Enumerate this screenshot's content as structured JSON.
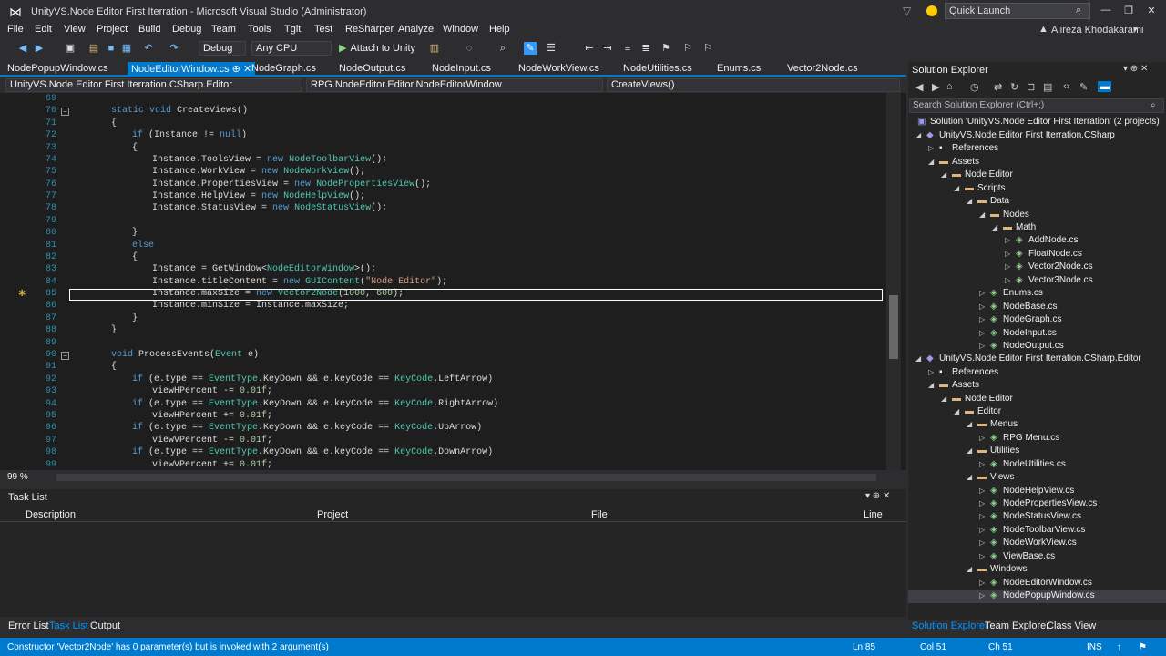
{
  "window": {
    "title": "UnityVS.Node Editor First Iterration - Microsoft Visual Studio (Administrator)",
    "quick_launch": "Quick Launch",
    "user": "Alireza Khodakarami"
  },
  "menu": [
    "File",
    "Edit",
    "View",
    "Project",
    "Build",
    "Debug",
    "Team",
    "Tools",
    "Tgit",
    "Test",
    "ReSharper",
    "Analyze",
    "Window",
    "Help"
  ],
  "toolbar": {
    "config": "Debug",
    "platform": "Any CPU",
    "attach": "Attach to Unity"
  },
  "tabs": [
    {
      "label": "NodePopupWindow.cs",
      "active": false
    },
    {
      "label": "NodeEditorWindow.cs",
      "active": true
    },
    {
      "label": "NodeGraph.cs",
      "active": false
    },
    {
      "label": "NodeOutput.cs",
      "active": false
    },
    {
      "label": "NodeInput.cs",
      "active": false
    },
    {
      "label": "NodeWorkView.cs",
      "active": false
    },
    {
      "label": "NodeUtilities.cs",
      "active": false
    },
    {
      "label": "Enums.cs",
      "active": false
    },
    {
      "label": "Vector2Node.cs",
      "active": false
    }
  ],
  "navbar": {
    "project": "UnityVS.Node Editor First Iterration.CSharp.Editor",
    "class": "RPG.NodeEditor.Editor.NodeEditorWindow",
    "member": "CreateViews()"
  },
  "code": {
    "line_numbers": [
      "69",
      "70",
      "71",
      "72",
      "73",
      "74",
      "75",
      "76",
      "77",
      "78",
      "79",
      "80",
      "81",
      "82",
      "83",
      "84",
      "85",
      "86",
      "87",
      "88",
      "89",
      "90",
      "91",
      "92",
      "93",
      "94",
      "95",
      "96",
      "97",
      "98",
      "99"
    ],
    "zoom": "99 %"
  },
  "tasklist": {
    "title": "Task List",
    "columns": [
      "Description",
      "Project",
      "File",
      "Line"
    ]
  },
  "bottom_tabs": [
    "Error List",
    "Task List",
    "Output"
  ],
  "solution_explorer": {
    "title": "Solution Explorer",
    "search_placeholder": "Search Solution Explorer (Ctrl+;)",
    "tree": [
      {
        "label": "Solution 'UnityVS.Node Editor First Iterration' (2 projects)",
        "kind": "solution"
      },
      {
        "label": "UnityVS.Node Editor First Iterration.CSharp",
        "kind": "project"
      },
      {
        "label": "References",
        "kind": "refs"
      },
      {
        "label": "Assets",
        "kind": "folder"
      },
      {
        "label": "Node Editor",
        "kind": "folder"
      },
      {
        "label": "Scripts",
        "kind": "folder"
      },
      {
        "label": "Data",
        "kind": "folder"
      },
      {
        "label": "Nodes",
        "kind": "folder"
      },
      {
        "label": "Math",
        "kind": "folder"
      },
      {
        "label": "AddNode.cs",
        "kind": "cs"
      },
      {
        "label": "FloatNode.cs",
        "kind": "cs"
      },
      {
        "label": "Vector2Node.cs",
        "kind": "cs"
      },
      {
        "label": "Vector3Node.cs",
        "kind": "cs"
      },
      {
        "label": "Enums.cs",
        "kind": "cs"
      },
      {
        "label": "NodeBase.cs",
        "kind": "cs"
      },
      {
        "label": "NodeGraph.cs",
        "kind": "cs"
      },
      {
        "label": "NodeInput.cs",
        "kind": "cs"
      },
      {
        "label": "NodeOutput.cs",
        "kind": "cs"
      },
      {
        "label": "UnityVS.Node Editor First Iterration.CSharp.Editor",
        "kind": "project"
      },
      {
        "label": "References",
        "kind": "refs"
      },
      {
        "label": "Assets",
        "kind": "folder"
      },
      {
        "label": "Node Editor",
        "kind": "folder"
      },
      {
        "label": "Editor",
        "kind": "folder"
      },
      {
        "label": "Menus",
        "kind": "folder"
      },
      {
        "label": "RPG Menu.cs",
        "kind": "cs"
      },
      {
        "label": "Utilities",
        "kind": "folder"
      },
      {
        "label": "NodeUtilities.cs",
        "kind": "cs"
      },
      {
        "label": "Views",
        "kind": "folder"
      },
      {
        "label": "NodeHelpView.cs",
        "kind": "cs"
      },
      {
        "label": "NodePropertiesView.cs",
        "kind": "cs"
      },
      {
        "label": "NodeStatusView.cs",
        "kind": "cs"
      },
      {
        "label": "NodeToolbarView.cs",
        "kind": "cs"
      },
      {
        "label": "NodeWorkView.cs",
        "kind": "cs"
      },
      {
        "label": "ViewBase.cs",
        "kind": "cs"
      },
      {
        "label": "Windows",
        "kind": "folder"
      },
      {
        "label": "NodeEditorWindow.cs",
        "kind": "cs"
      },
      {
        "label": "NodePopupWindow.cs",
        "kind": "cs"
      }
    ],
    "bottom_tabs": [
      "Solution Explorer",
      "Team Explorer",
      "Class View"
    ]
  },
  "status": {
    "message": "Constructor 'Vector2Node' has 0 parameter(s) but is invoked with 2 argument(s)",
    "ln": "Ln 85",
    "col": "Col 51",
    "ch": "Ch 51",
    "ins": "INS"
  }
}
